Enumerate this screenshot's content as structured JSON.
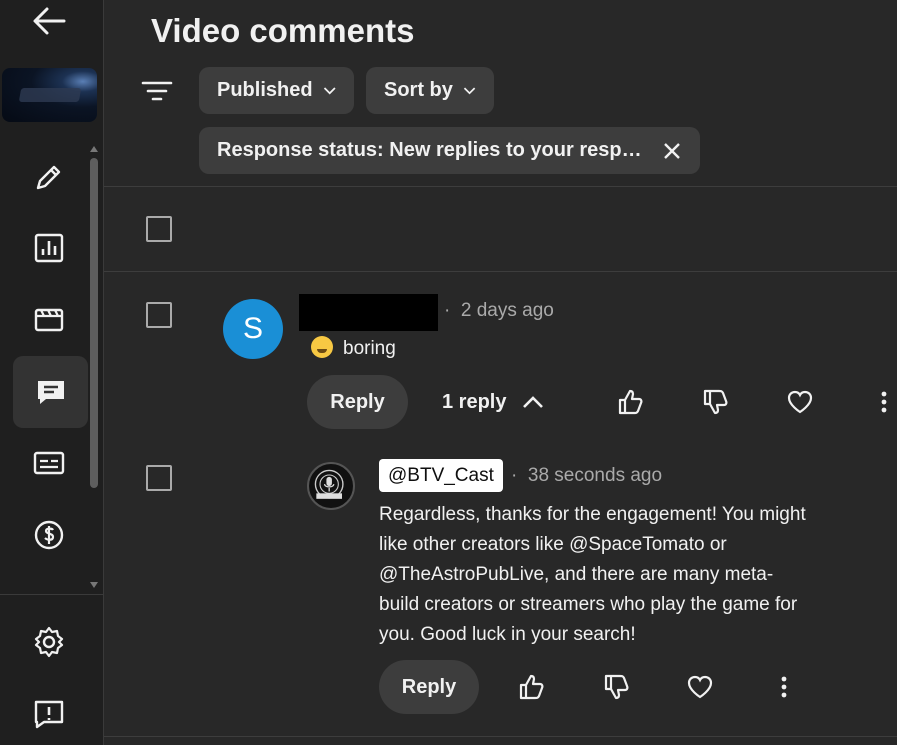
{
  "page": {
    "title": "Video comments"
  },
  "filters": {
    "published_label": "Published",
    "sort_label": "Sort by",
    "status_chip": "Response status: New replies to your respo…"
  },
  "comment": {
    "time": "2 days ago",
    "avatar_letter": "S",
    "text": "boring",
    "reply_label": "Reply",
    "replies_toggle": "1 reply"
  },
  "reply": {
    "author": "@BTV_Cast",
    "time": "38 seconds ago",
    "avatar_text": "BEYOND VERSE",
    "text": "Regardless, thanks for the engagement!  You might like other creators like @SpaceTomato or @TheAstroPubLive, and there are many meta-build creators or streamers who play the game for you. Good luck in your search!",
    "reply_label": "Reply"
  },
  "icons": {
    "back": "arrow-left-icon",
    "details": "pencil-icon",
    "analytics": "analytics-icon",
    "editor": "clapperboard-icon",
    "comments": "comment-icon",
    "subtitles": "subtitles-icon",
    "monetization": "dollar-icon",
    "settings": "gear-icon",
    "feedback": "feedback-icon"
  },
  "colors": {
    "background": "#282828",
    "chip": "#3d3d3d",
    "avatar_s": "#1a8fd6"
  }
}
